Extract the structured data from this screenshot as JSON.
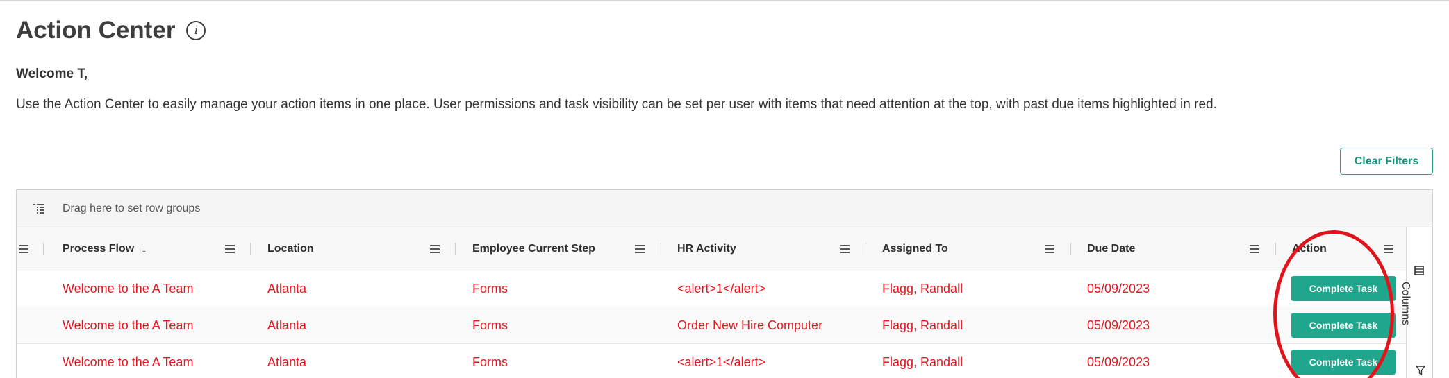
{
  "page": {
    "title": "Action Center",
    "info_glyph": "i",
    "welcome": "Welcome T,",
    "description": "Use the Action Center to easily manage your action items in one place. User permissions and task visibility can be set per user with items that need attention at the top, with past due items highlighted in red."
  },
  "toolbar": {
    "clear_filters_label": "Clear Filters"
  },
  "grid": {
    "group_bar_text": "Drag here to set row groups",
    "side_panel_label": "Columns",
    "sort_indicator": "↓",
    "sorted_column": "Process Flow",
    "columns": [
      {
        "key": "process_flow",
        "label": "Process Flow"
      },
      {
        "key": "location",
        "label": "Location"
      },
      {
        "key": "employee_current_step",
        "label": "Employee Current Step"
      },
      {
        "key": "hr_activity",
        "label": "HR Activity"
      },
      {
        "key": "assigned_to",
        "label": "Assigned To"
      },
      {
        "key": "due_date",
        "label": "Due Date"
      },
      {
        "key": "action",
        "label": "Action"
      }
    ],
    "rows": [
      {
        "process_flow": "Welcome to the A Team",
        "location": "Atlanta",
        "employee_current_step": "Forms",
        "hr_activity": "<alert>1</alert>",
        "assigned_to": "Flagg, Randall",
        "due_date": "05/09/2023",
        "action": "Complete Task"
      },
      {
        "process_flow": "Welcome to the A Team",
        "location": "Atlanta",
        "employee_current_step": "Forms",
        "hr_activity": "Order New Hire Computer",
        "assigned_to": "Flagg, Randall",
        "due_date": "05/09/2023",
        "action": "Complete Task"
      },
      {
        "process_flow": "Welcome to the A Team",
        "location": "Atlanta",
        "employee_current_step": "Forms",
        "hr_activity": "<alert>1</alert>",
        "assigned_to": "Flagg, Randall",
        "due_date": "05/09/2023",
        "action": "Complete Task"
      }
    ]
  },
  "colors": {
    "accent": "#1fa68c",
    "past_due_text": "#e8141e",
    "annotation": "#e1141c"
  },
  "icons": {
    "info": "info-icon",
    "row_group": "row-group-icon",
    "column_menu": "menu-icon",
    "columns_panel": "columns-icon",
    "filter": "filter-icon"
  }
}
